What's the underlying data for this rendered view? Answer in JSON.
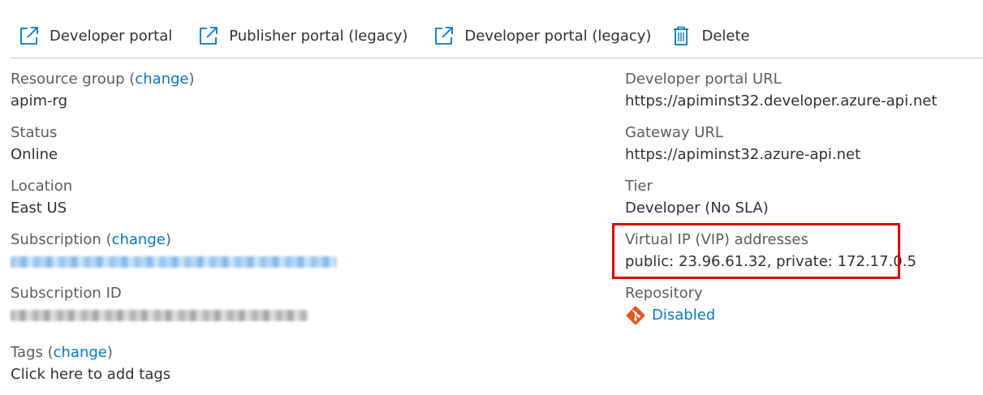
{
  "toolbar": {
    "items": [
      {
        "label": "Developer portal",
        "icon": "external-link-icon"
      },
      {
        "label": "Publisher portal (legacy)",
        "icon": "external-link-icon"
      },
      {
        "label": "Developer portal (legacy)",
        "icon": "external-link-icon"
      },
      {
        "label": "Delete",
        "icon": "trash-icon"
      }
    ]
  },
  "essentials": {
    "left": {
      "resource_group": {
        "label": "Resource group",
        "paren_open": " (",
        "change": "change",
        "paren_close": ")",
        "value": "apim-rg"
      },
      "status": {
        "label": "Status",
        "value": "Online"
      },
      "location": {
        "label": "Location",
        "value": "East US"
      },
      "subscription": {
        "label": "Subscription",
        "paren_open": " (",
        "change": "change",
        "paren_close": ")"
      },
      "subscription_id": {
        "label": "Subscription ID"
      },
      "tags": {
        "label": "Tags",
        "paren_open": " (",
        "change": "change",
        "paren_close": ")",
        "value": "Click here to add tags"
      }
    },
    "right": {
      "developer_portal_url": {
        "label": "Developer portal URL",
        "value": "https://apiminst32.developer.azure-api.net"
      },
      "gateway_url": {
        "label": "Gateway URL",
        "value": "https://apiminst32.azure-api.net"
      },
      "tier": {
        "label": "Tier",
        "value": "Developer (No SLA)"
      },
      "vip": {
        "label": "Virtual IP (VIP) addresses",
        "value": "public: 23.96.61.32, private: 172.17.0.5"
      },
      "repository": {
        "label": "Repository",
        "value": "Disabled",
        "icon": "git-icon"
      }
    }
  },
  "colors": {
    "link": "#0078d4",
    "text": "#323130",
    "label": "#605e5c",
    "highlight": "#e00000",
    "git": "#e05a1e",
    "icon_blue": "#0078d4"
  }
}
